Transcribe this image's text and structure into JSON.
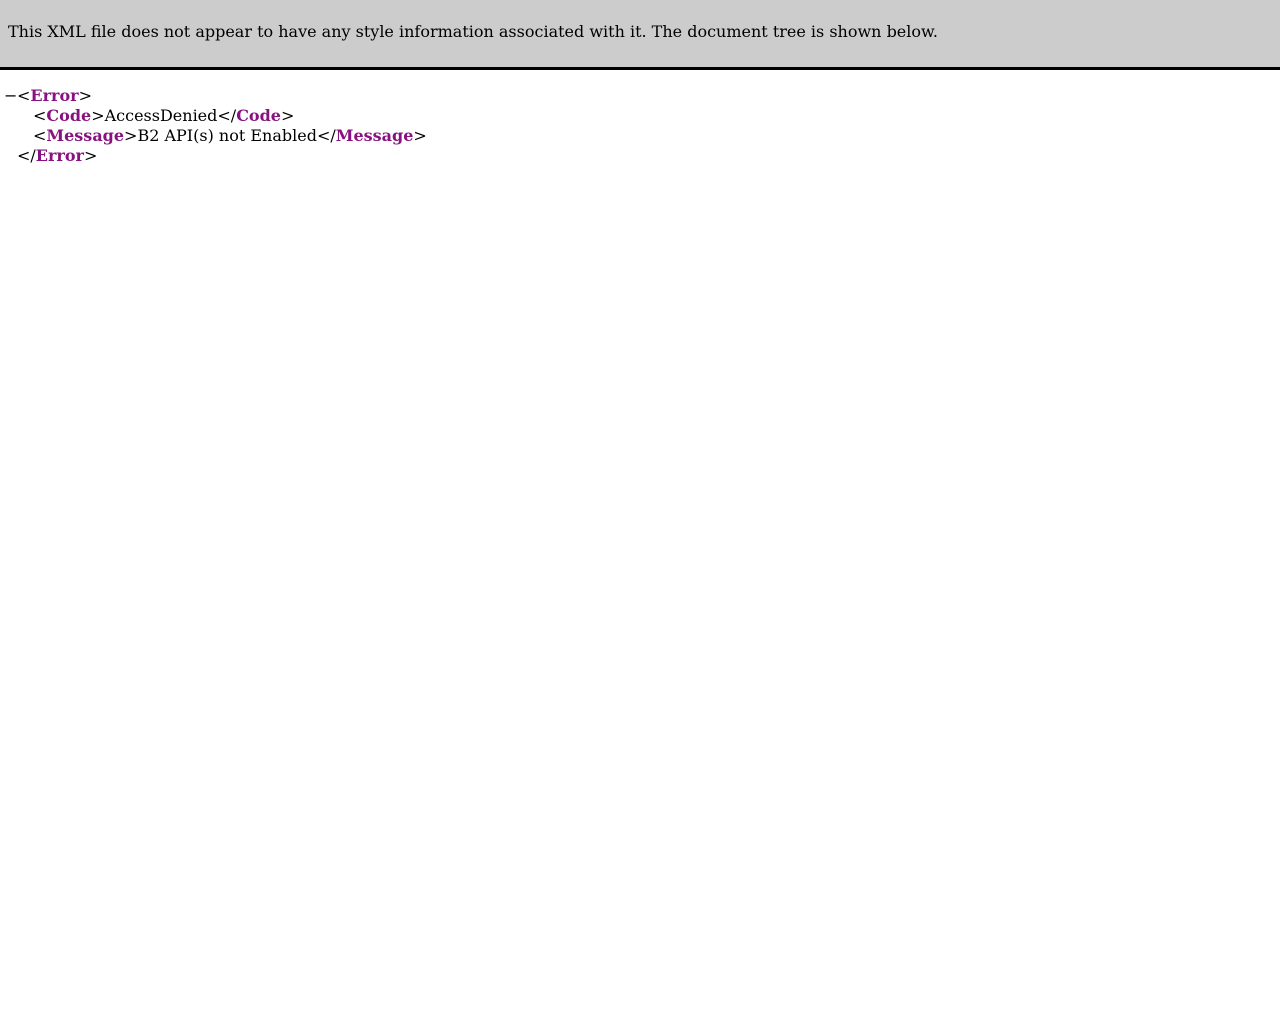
{
  "info_bar": {
    "text": "This XML file does not appear to have any style information associated with it. The document tree is shown below."
  },
  "tree": {
    "collapse_symbol": "−",
    "root": {
      "tag": "Error",
      "children": [
        {
          "tag": "Code",
          "value": "AccessDenied"
        },
        {
          "tag": "Message",
          "value": "B2 API(s) not Enabled"
        }
      ]
    },
    "syntax": {
      "lt": "<",
      "gt": ">",
      "lt_slash": "</"
    }
  },
  "colors": {
    "info_bar_bg": "#cccccc",
    "tag_name": "#881280",
    "text": "#000000"
  }
}
